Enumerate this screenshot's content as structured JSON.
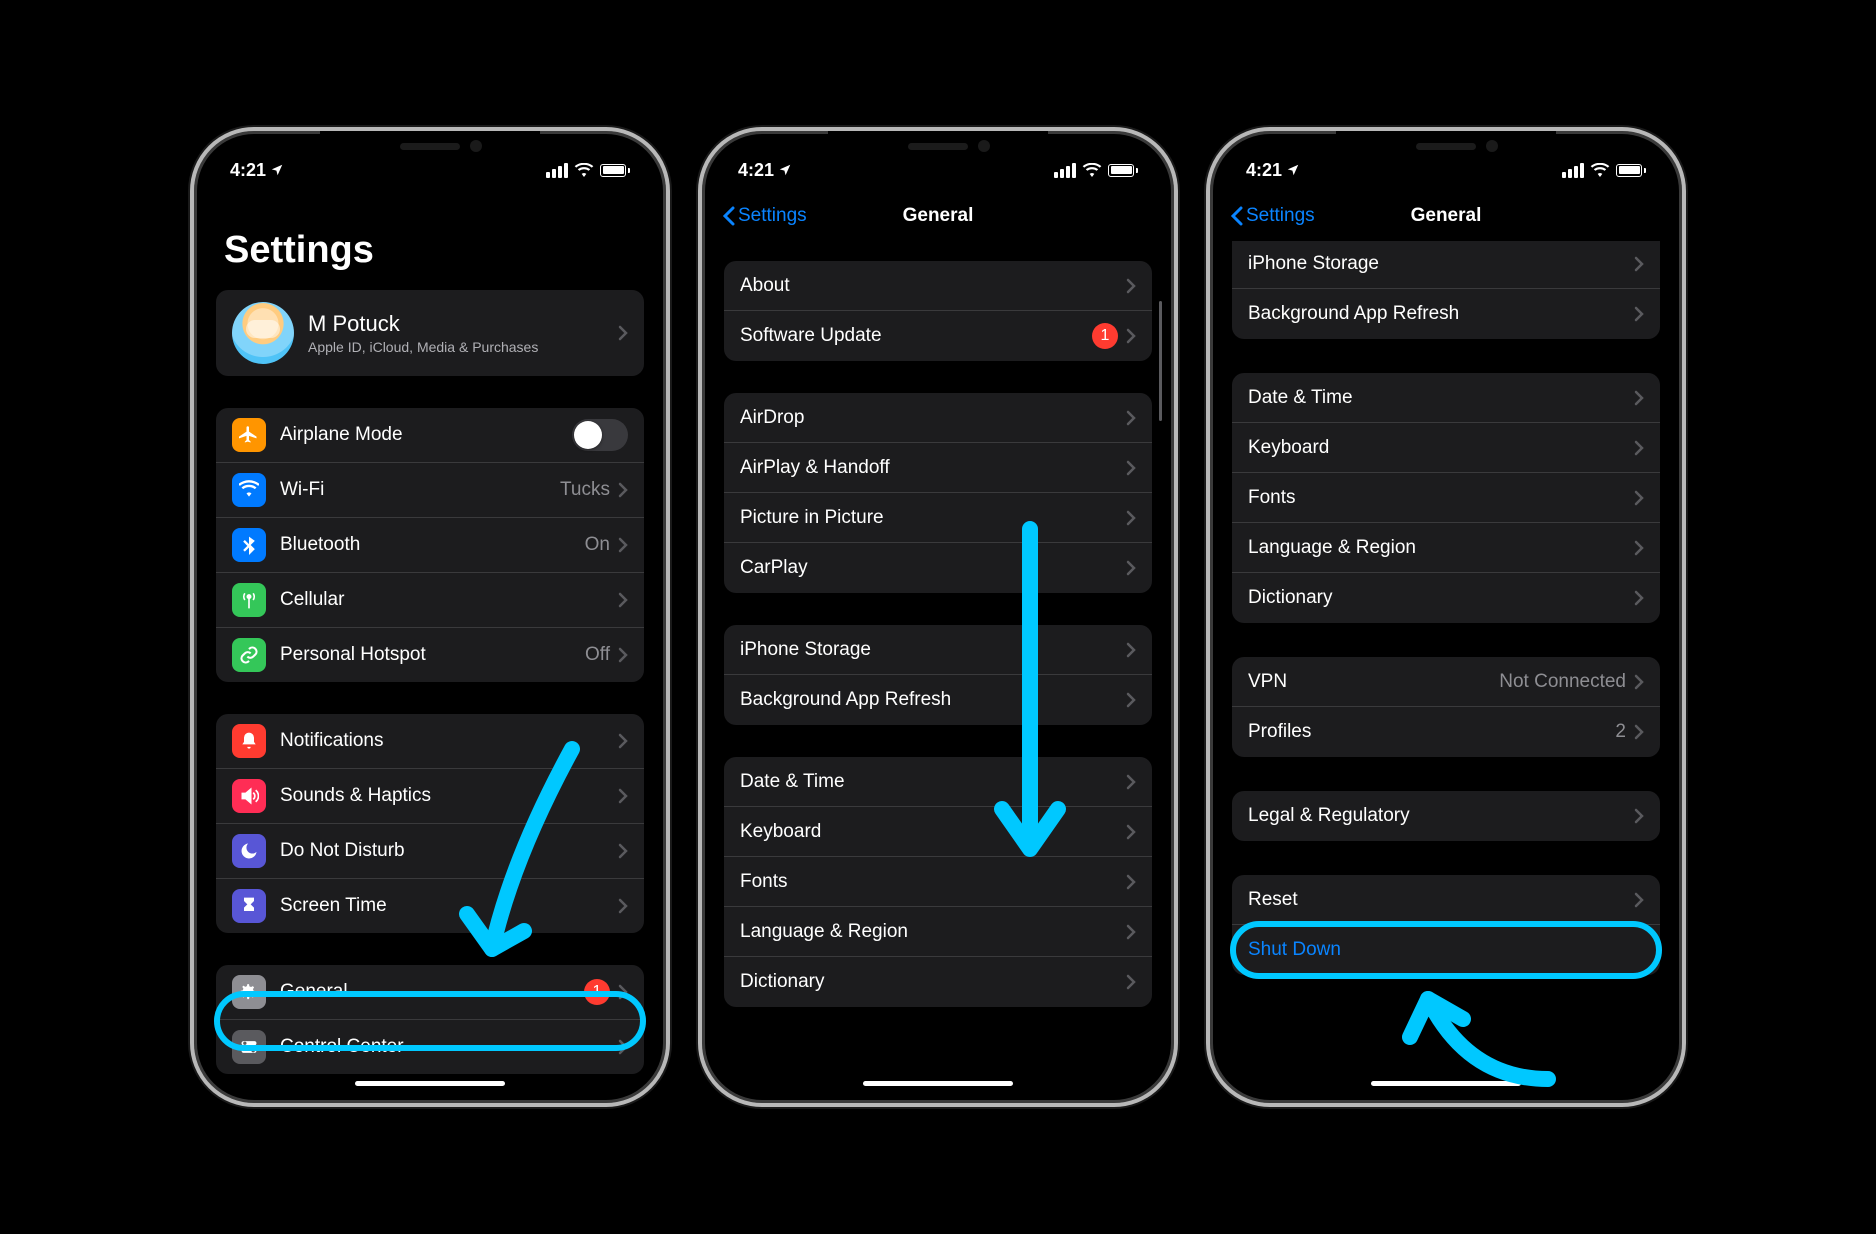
{
  "status": {
    "time": "4:21",
    "location_icon": "location-arrow"
  },
  "phone1": {
    "title": "Settings",
    "profile": {
      "name": "M Potuck",
      "subtitle": "Apple ID, iCloud, Media & Purchases"
    },
    "group1": [
      {
        "icon": "airplane",
        "color": "ic-orange",
        "label": "Airplane Mode",
        "toggle": false
      },
      {
        "icon": "wifi",
        "color": "ic-blue",
        "label": "Wi-Fi",
        "detail": "Tucks"
      },
      {
        "icon": "bluetooth",
        "color": "ic-blue",
        "label": "Bluetooth",
        "detail": "On"
      },
      {
        "icon": "antenna",
        "color": "ic-green",
        "label": "Cellular"
      },
      {
        "icon": "link",
        "color": "ic-green",
        "label": "Personal Hotspot",
        "detail": "Off"
      }
    ],
    "group2": [
      {
        "icon": "bell",
        "color": "ic-red",
        "label": "Notifications"
      },
      {
        "icon": "speaker",
        "color": "ic-pink",
        "label": "Sounds & Haptics"
      },
      {
        "icon": "moon",
        "color": "ic-indigo",
        "label": "Do Not Disturb"
      },
      {
        "icon": "hourglass",
        "color": "ic-indigo",
        "label": "Screen Time"
      }
    ],
    "group3": [
      {
        "icon": "gear",
        "color": "ic-gray",
        "label": "General",
        "badge": "1"
      },
      {
        "icon": "switches",
        "color": "ic-darkgray",
        "label": "Control Center"
      }
    ]
  },
  "phone2": {
    "back": "Settings",
    "title": "General",
    "groups": [
      [
        {
          "label": "About"
        },
        {
          "label": "Software Update",
          "badge": "1"
        }
      ],
      [
        {
          "label": "AirDrop"
        },
        {
          "label": "AirPlay & Handoff"
        },
        {
          "label": "Picture in Picture"
        },
        {
          "label": "CarPlay"
        }
      ],
      [
        {
          "label": "iPhone Storage"
        },
        {
          "label": "Background App Refresh"
        }
      ],
      [
        {
          "label": "Date & Time"
        },
        {
          "label": "Keyboard"
        },
        {
          "label": "Fonts"
        },
        {
          "label": "Language & Region"
        },
        {
          "label": "Dictionary"
        }
      ]
    ]
  },
  "phone3": {
    "back": "Settings",
    "title": "General",
    "groups": [
      [
        {
          "label": "iPhone Storage"
        },
        {
          "label": "Background App Refresh"
        }
      ],
      [
        {
          "label": "Date & Time"
        },
        {
          "label": "Keyboard"
        },
        {
          "label": "Fonts"
        },
        {
          "label": "Language & Region"
        },
        {
          "label": "Dictionary"
        }
      ],
      [
        {
          "label": "VPN",
          "detail": "Not Connected"
        },
        {
          "label": "Profiles",
          "detail": "2"
        }
      ],
      [
        {
          "label": "Legal & Regulatory"
        }
      ],
      [
        {
          "label": "Reset"
        },
        {
          "label": "Shut Down",
          "blue": true,
          "no_chevron": true
        }
      ]
    ]
  },
  "annotations": {
    "highlight_color": "#00c8ff"
  }
}
